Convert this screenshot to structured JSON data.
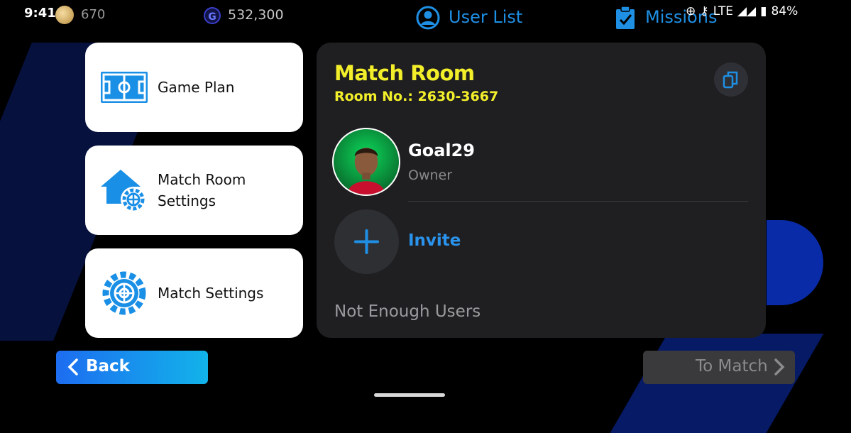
{
  "status_bar": {
    "time": "9:41",
    "coin_count": "670",
    "gp_count": "532,300",
    "network": "LTE",
    "battery": "84%"
  },
  "tabs": {
    "user_list": "User List",
    "missions": "Missions"
  },
  "menu": {
    "game_plan": "Game Plan",
    "match_room_settings_line1": "Match Room",
    "match_room_settings_line2": "Settings",
    "match_settings": "Match Settings"
  },
  "room": {
    "title": "Match Room",
    "room_no": "Room No.: 2630-3667",
    "owner_name": "Goal29",
    "owner_role": "Owner",
    "invite_label": "Invite",
    "status_text": "Not Enough Users"
  },
  "buttons": {
    "back": "Back",
    "to_match": "To Match"
  },
  "colors": {
    "accent_blue": "#1f8fe4",
    "title_yellow": "#f2ef2a",
    "panel_bg": "#1f1f22"
  }
}
